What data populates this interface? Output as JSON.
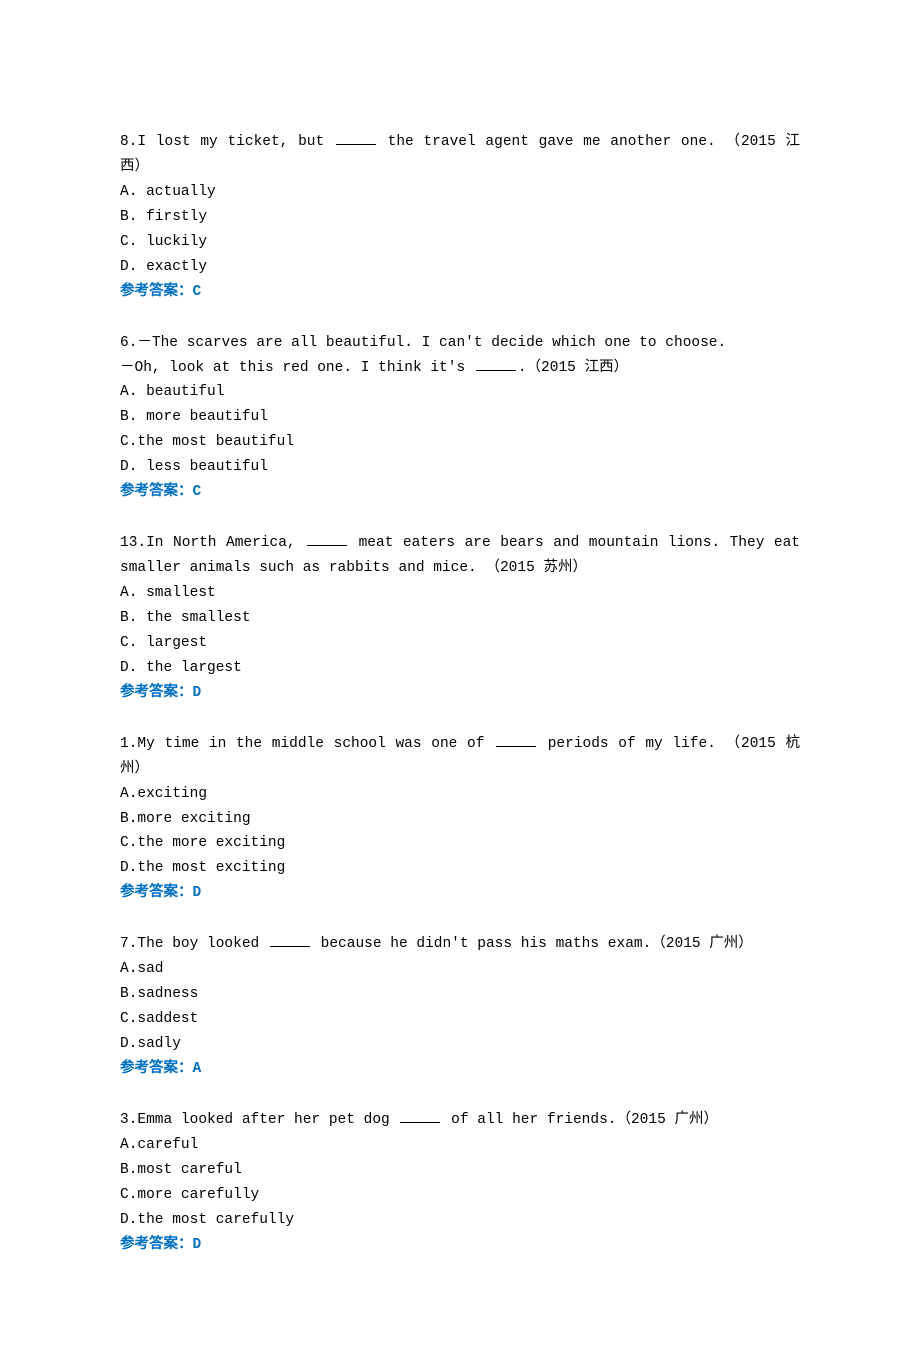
{
  "answer_label_prefix": "参考答案：",
  "questions": [
    {
      "num": "8",
      "stem_before": ".I lost my ticket, but ",
      "stem_after": " the travel agent gave me another one. （2015 江西）",
      "options": [
        "A. actually",
        "B. firstly",
        "C. luckily",
        "D. exactly"
      ],
      "answer": "C"
    },
    {
      "num": "6",
      "stem_before": ".－The scarves are all beautiful. I can't decide which one to choose.",
      "line2_before": "－Oh, look at this red one. I think it's ",
      "line2_after": ".（2015 江西）",
      "options": [
        "A. beautiful",
        "B. more beautiful",
        "C.the most beautiful",
        "D. less beautiful"
      ],
      "answer": "C"
    },
    {
      "num": "13",
      "stem_before": ".In North America, ",
      "stem_after": " meat eaters are bears and mountain lions. They eat smaller animals such as rabbits and mice. （2015 苏州）",
      "options": [
        "A. smallest",
        "B. the smallest",
        "C. largest",
        "D. the largest"
      ],
      "answer": "D"
    },
    {
      "num": "1",
      "stem_before": ".My time in the middle school was one of ",
      "stem_after": " periods of my life. （2015 杭州）",
      "options": [
        "A.exciting",
        "B.more exciting",
        "C.the more exciting",
        "D.the most exciting"
      ],
      "answer": "D"
    },
    {
      "num": "7",
      "stem_before": ".The boy looked ",
      "stem_after": " because he didn't pass his maths exam.（2015 广州）",
      "options": [
        "A.sad",
        "B.sadness",
        "C.saddest",
        "D.sadly"
      ],
      "answer": "A"
    },
    {
      "num": "3",
      "stem_before": ".Emma looked after her pet dog ",
      "stem_after": " of all her friends.（2015 广州）",
      "options": [
        "A.careful",
        "B.most careful",
        "C.more carefully",
        "D.the most carefully"
      ],
      "answer": "D"
    }
  ]
}
